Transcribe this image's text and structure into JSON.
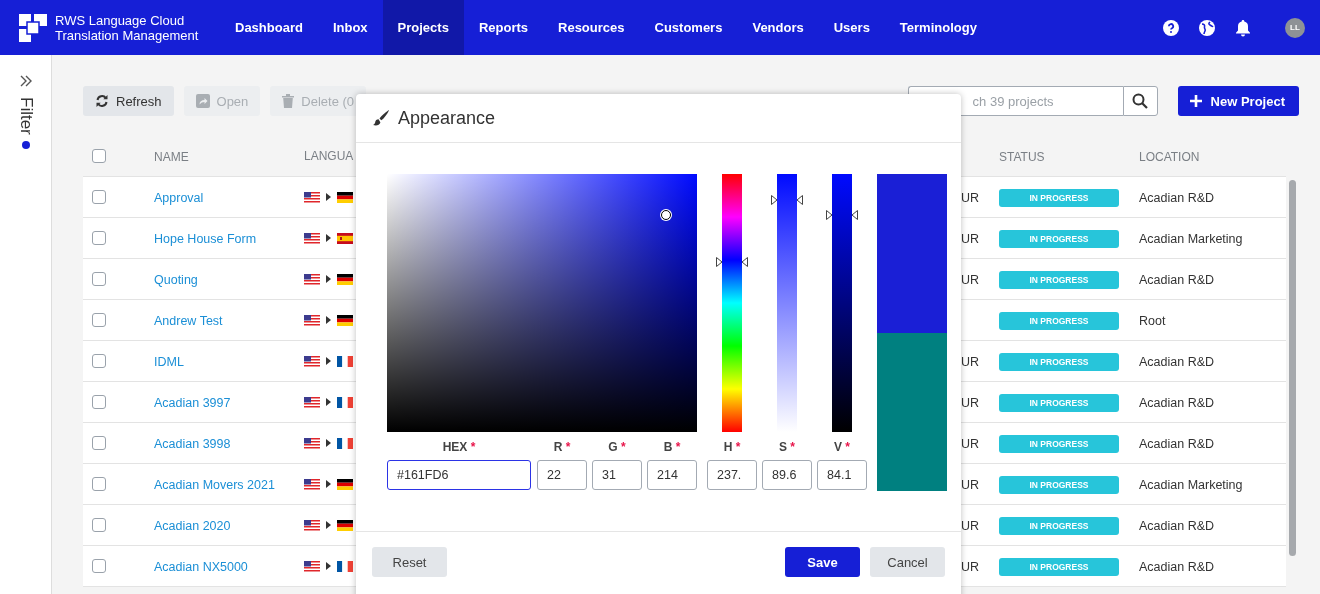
{
  "app": {
    "title_lines": [
      "RWS Language Cloud",
      "Translation Management"
    ]
  },
  "nav": [
    {
      "label": "Dashboard",
      "selected": false
    },
    {
      "label": "Inbox",
      "selected": false
    },
    {
      "label": "Projects",
      "selected": true
    },
    {
      "label": "Reports",
      "selected": false
    },
    {
      "label": "Resources",
      "selected": false
    },
    {
      "label": "Customers",
      "selected": false
    },
    {
      "label": "Vendors",
      "selected": false
    },
    {
      "label": "Users",
      "selected": false
    },
    {
      "label": "Terminology",
      "selected": false
    }
  ],
  "user": {
    "initials": "LL"
  },
  "sidebar": {
    "label": "Filter",
    "active": true
  },
  "toolbar": [
    {
      "kind": "refresh",
      "label": "Refresh",
      "disabled": false
    },
    {
      "kind": "open",
      "label": "Open",
      "disabled": true
    },
    {
      "kind": "delete",
      "label": "Delete (0",
      "disabled": true
    }
  ],
  "search": {
    "placeholder": "ch 39 projects"
  },
  "new_button": {
    "label": "New Project"
  },
  "table": {
    "select_all": {
      "checked": false
    },
    "columns": [
      "NAME",
      "LANGUA",
      "STATUS",
      "LOCATION"
    ],
    "rows": [
      {
        "checked": false,
        "name": "Approval",
        "flags": [
          {
            "kind": "us"
          },
          {
            "kind": "de"
          }
        ],
        "currency": "UR",
        "status": "IN PROGRESS",
        "location": "Acadian R&D"
      },
      {
        "checked": false,
        "name": "Hope House Form",
        "flags": [
          {
            "kind": "us"
          },
          {
            "kind": "es"
          }
        ],
        "currency": "UR",
        "status": "IN PROGRESS",
        "location": "Acadian Marketing"
      },
      {
        "checked": false,
        "name": "Quoting",
        "flags": [
          {
            "kind": "us"
          },
          {
            "kind": "de"
          }
        ],
        "currency": "UR",
        "status": "IN PROGRESS",
        "location": "Acadian R&D"
      },
      {
        "checked": false,
        "name": "Andrew Test",
        "flags": [
          {
            "kind": "us"
          },
          {
            "kind": "de"
          }
        ],
        "status": "IN PROGRESS",
        "location": "Root"
      },
      {
        "checked": false,
        "name": "IDML",
        "flags": [
          {
            "kind": "us"
          },
          {
            "kind": "fr"
          }
        ],
        "currency": "UR",
        "status": "IN PROGRESS",
        "location": "Acadian R&D"
      },
      {
        "checked": false,
        "name": "Acadian 3997",
        "flags": [
          {
            "kind": "us"
          },
          {
            "kind": "fr"
          }
        ],
        "currency": "UR",
        "status": "IN PROGRESS",
        "location": "Acadian R&D"
      },
      {
        "checked": false,
        "name": "Acadian 3998",
        "flags": [
          {
            "kind": "us"
          },
          {
            "kind": "fr"
          }
        ],
        "currency": "UR",
        "status": "IN PROGRESS",
        "location": "Acadian R&D"
      },
      {
        "checked": false,
        "name": "Acadian Movers 2021",
        "flags": [
          {
            "kind": "us"
          },
          {
            "kind": "de"
          }
        ],
        "currency": "UR",
        "status": "IN PROGRESS",
        "location": "Acadian Marketing"
      },
      {
        "checked": false,
        "name": "Acadian 2020",
        "flags": [
          {
            "kind": "us"
          },
          {
            "kind": "de"
          }
        ],
        "currency": "UR",
        "status": "IN PROGRESS",
        "location": "Acadian R&D"
      },
      {
        "checked": false,
        "name": "Acadian NX5000",
        "flags": [
          {
            "kind": "us"
          },
          {
            "kind": "fr"
          }
        ],
        "currency": "UR",
        "status": "IN PROGRESS",
        "location": "Acadian R&D"
      }
    ]
  },
  "dialog": {
    "title": "Appearance",
    "sliders": [
      {
        "kind": "hue",
        "level": 0.66
      },
      {
        "kind": "saturation",
        "level": 0.9
      },
      {
        "kind": "value",
        "level": 0.84
      }
    ],
    "swatches": [
      {
        "color": "#1a1fd6"
      },
      {
        "color": "#008080"
      }
    ],
    "fields": [
      {
        "kind": "hex",
        "label": "HEX",
        "mark": "*",
        "value": "#161FD6",
        "focused": true
      },
      {
        "kind": "channel",
        "label": "R",
        "mark": "*",
        "value": "22",
        "focused": false
      },
      {
        "kind": "channel",
        "label": "G",
        "mark": "*",
        "value": "31",
        "focused": false
      },
      {
        "kind": "channel",
        "label": "B",
        "mark": "*",
        "value": "214",
        "focused": false
      },
      {
        "kind": "channel",
        "label": "H",
        "mark": "*",
        "value": "237.",
        "focused": false
      },
      {
        "kind": "channel",
        "label": "S",
        "mark": "*",
        "value": "89.6",
        "focused": false
      },
      {
        "kind": "channel",
        "label": "V",
        "mark": "*",
        "value": "84.1",
        "focused": false
      }
    ],
    "buttons": [
      {
        "kind": "secondary",
        "label": "Reset"
      },
      {
        "kind": "primary",
        "label": "Save"
      },
      {
        "kind": "secondary",
        "label": "Cancel"
      }
    ]
  }
}
